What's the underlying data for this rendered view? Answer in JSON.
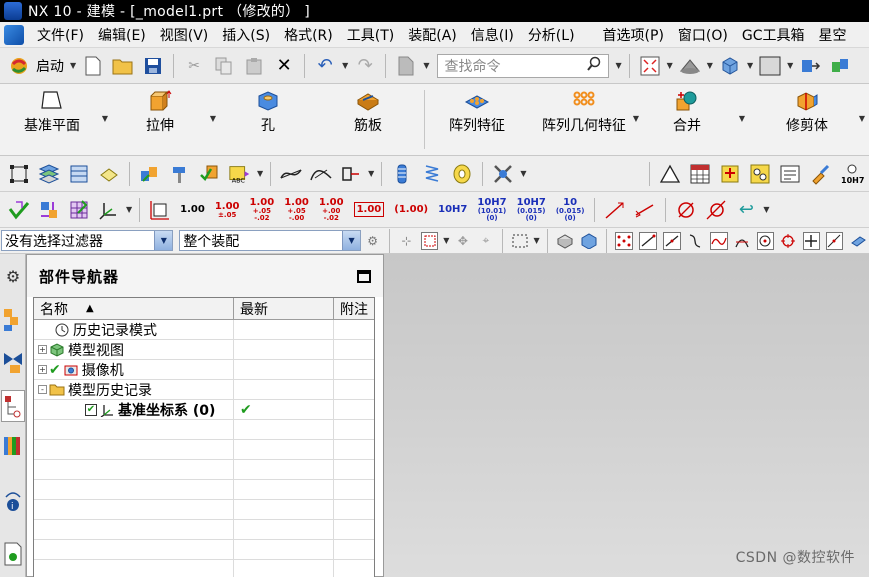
{
  "window": {
    "title": "NX 10 - 建模 - [_model1.prt （修改的） ]"
  },
  "menu": {
    "items": [
      "文件(F)",
      "编辑(E)",
      "视图(V)",
      "插入(S)",
      "格式(R)",
      "工具(T)",
      "装配(A)",
      "信息(I)",
      "分析(L)",
      "首选项(P)",
      "窗口(O)",
      "GC工具箱",
      "星空"
    ]
  },
  "standard_toolbar": {
    "start_label": "启动",
    "command_search_placeholder": "查找命令"
  },
  "ribbon": {
    "groups": [
      {
        "label": "基准平面",
        "icon": "datum-plane-icon",
        "has_dropdown": true
      },
      {
        "label": "拉伸",
        "icon": "extrude-icon",
        "has_dropdown": true
      },
      {
        "label": "孔",
        "icon": "hole-icon",
        "has_dropdown": false
      },
      {
        "label": "筋板",
        "icon": "rib-icon",
        "has_dropdown": false
      },
      {
        "label": "阵列特征",
        "icon": "pattern-feature-icon",
        "has_dropdown": false
      },
      {
        "label": "阵列几何特征",
        "icon": "pattern-geometry-icon",
        "has_dropdown": true
      },
      {
        "label": "合并",
        "icon": "unite-icon",
        "has_dropdown": true
      },
      {
        "label": "修剪体",
        "icon": "trim-body-icon",
        "has_dropdown": true
      }
    ]
  },
  "pmi_toolbar": {
    "tolerances": [
      {
        "text": "1.00",
        "style": "plain"
      },
      {
        "text": "1.00\n±.05",
        "style": "red"
      },
      {
        "text": "1.00\n+.05\n-.02",
        "style": "red"
      },
      {
        "text": "1.00\n+.05\n-.00",
        "style": "red"
      },
      {
        "text": "1.00\n+.00\n-.02",
        "style": "red"
      },
      {
        "text": "1.00",
        "style": "box"
      },
      {
        "text": "(1.00)",
        "style": "red"
      },
      {
        "text": "10H7",
        "style": "blue"
      },
      {
        "text": "10H7\n(10.01)\n(0)",
        "style": "blue"
      },
      {
        "text": "10H7\n(0.015)\n(0)",
        "style": "blue"
      },
      {
        "text": "10\n(0.015)\n(0)",
        "style": "blue"
      }
    ],
    "extra_label": "10H7"
  },
  "selection_bar": {
    "filter_value": "没有选择过滤器",
    "scope_value": "整个装配"
  },
  "part_navigator": {
    "title": "部件导航器",
    "columns": [
      "名称",
      "最新",
      "附注"
    ],
    "rows": [
      {
        "indent": 0,
        "expander": "",
        "icon": "clock-icon",
        "name": "历史记录模式",
        "latest": "",
        "bold": false
      },
      {
        "indent": 0,
        "expander": "+",
        "icon": "model-views-icon",
        "name": "模型视图",
        "latest": "",
        "bold": false
      },
      {
        "indent": 0,
        "expander": "+",
        "icon": "camera-icon",
        "name": "摄像机",
        "latest": "",
        "bold": false
      },
      {
        "indent": 0,
        "expander": "-",
        "icon": "folder-icon",
        "name": "模型历史记录",
        "latest": "",
        "bold": false
      },
      {
        "indent": 1,
        "expander": "",
        "icon": "datum-csys-icon",
        "name": "基准坐标系 (0)",
        "latest": "✔",
        "bold": true
      },
      {
        "indent": 0,
        "expander": "",
        "icon": "",
        "name": "",
        "latest": "",
        "bold": false
      },
      {
        "indent": 0,
        "expander": "",
        "icon": "",
        "name": "",
        "latest": "",
        "bold": false
      },
      {
        "indent": 0,
        "expander": "",
        "icon": "",
        "name": "",
        "latest": "",
        "bold": false
      },
      {
        "indent": 0,
        "expander": "",
        "icon": "",
        "name": "",
        "latest": "",
        "bold": false
      },
      {
        "indent": 0,
        "expander": "",
        "icon": "",
        "name": "",
        "latest": "",
        "bold": false
      },
      {
        "indent": 0,
        "expander": "",
        "icon": "",
        "name": "",
        "latest": "",
        "bold": false
      },
      {
        "indent": 0,
        "expander": "",
        "icon": "",
        "name": "",
        "latest": "",
        "bold": false
      },
      {
        "indent": 0,
        "expander": "",
        "icon": "",
        "name": "",
        "latest": "",
        "bold": false
      }
    ]
  },
  "watermark": "CSDN @数控软件",
  "colors": {
    "title_bar": "#000000",
    "graphics_bg": "#cfcfcf",
    "check_green": "#1f9c1f",
    "tolerance_red": "#cc0000",
    "tolerance_blue": "#1a2fb8"
  }
}
